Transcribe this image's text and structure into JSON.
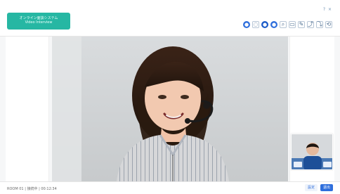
{
  "header": {
    "brand_line_1": "オンライン面談システム",
    "brand_line_2": "Video Interview",
    "top_right": "? ×"
  },
  "toolbar": {
    "btn_a": "●",
    "btn_b": "◌",
    "btn_c": "●",
    "btn_d": "●",
    "btn_e": "⌕",
    "btn_f": "▭",
    "btn_g": "✎",
    "btn_h": "⤴",
    "btn_i": "⤵",
    "btn_j": "⟲"
  },
  "footer": {
    "left_text": "ROOM 01  |  接続中  |  00:12:34",
    "right_btn_1": "設定",
    "right_btn_2": "退出"
  },
  "colors": {
    "brand": "#26b7a3",
    "accent": "#2f6fdc"
  }
}
